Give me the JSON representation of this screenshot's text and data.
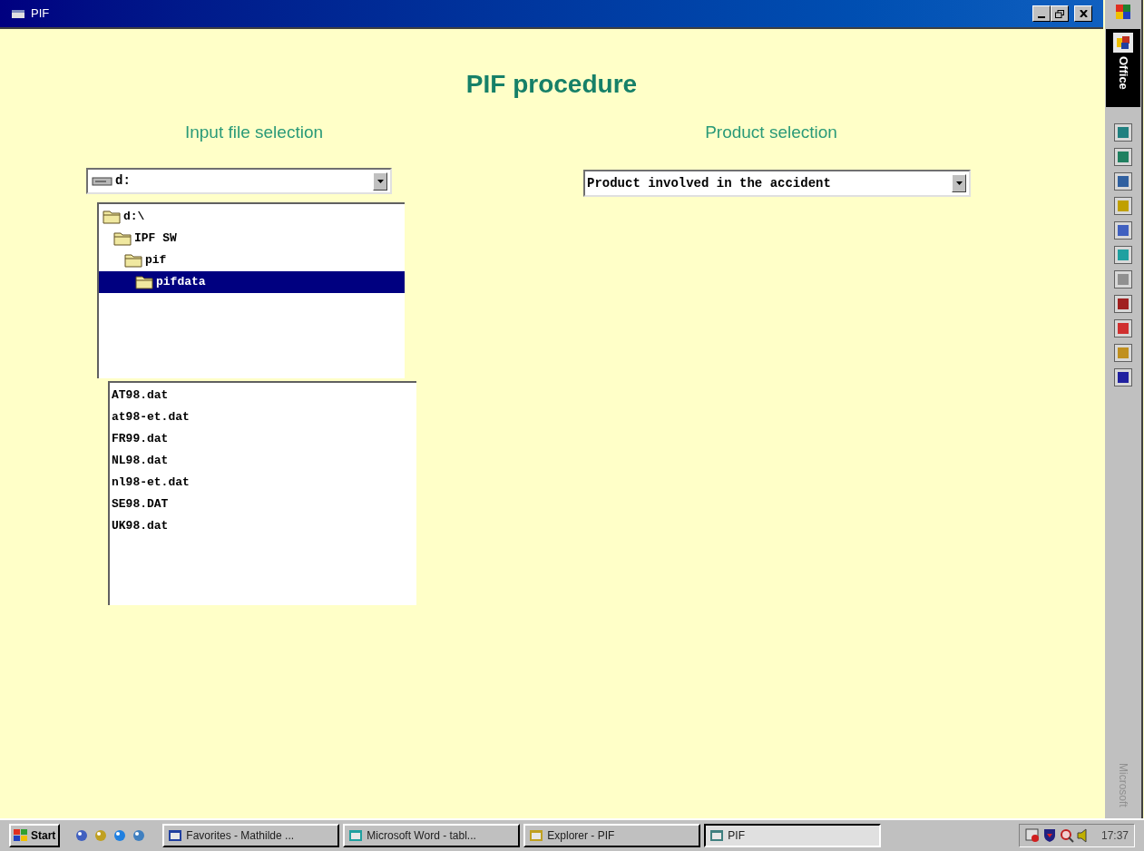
{
  "window": {
    "title": "PIF"
  },
  "heading": "PIF procedure",
  "input_section": {
    "label": "Input file selection",
    "drive": {
      "value": "d:"
    },
    "folder_tree": [
      {
        "label": "d:\\",
        "selected": false,
        "children": [
          {
            "label": "IPF SW",
            "selected": false,
            "children": [
              {
                "label": "pif",
                "selected": false,
                "children": [
                  {
                    "label": "pifdata",
                    "selected": true
                  }
                ]
              }
            ]
          }
        ]
      }
    ],
    "files": [
      {
        "label": "AT98.dat",
        "selected": false
      },
      {
        "label": "at98-et.dat",
        "selected": false
      },
      {
        "label": "FR99.dat",
        "selected": false
      },
      {
        "label": "NL98.dat",
        "selected": false
      },
      {
        "label": "nl98-et.dat",
        "selected": false
      },
      {
        "label": "SE98.DAT",
        "selected": false
      },
      {
        "label": "UK98.dat",
        "selected": false
      }
    ]
  },
  "product_section": {
    "label": "Product selection",
    "product": {
      "value": "Product involved in the accident"
    }
  },
  "office_bar": {
    "title": "Office",
    "footer": "Microsoft"
  },
  "taskbar": {
    "start": "Start",
    "tasks": [
      {
        "label": "Favorites - Mathilde ...",
        "selected": false
      },
      {
        "label": "Microsoft Word - tabl...",
        "selected": false
      },
      {
        "label": "Explorer - PIF",
        "selected": false
      },
      {
        "label": "PIF",
        "selected": true
      }
    ],
    "clock": "17:37"
  }
}
